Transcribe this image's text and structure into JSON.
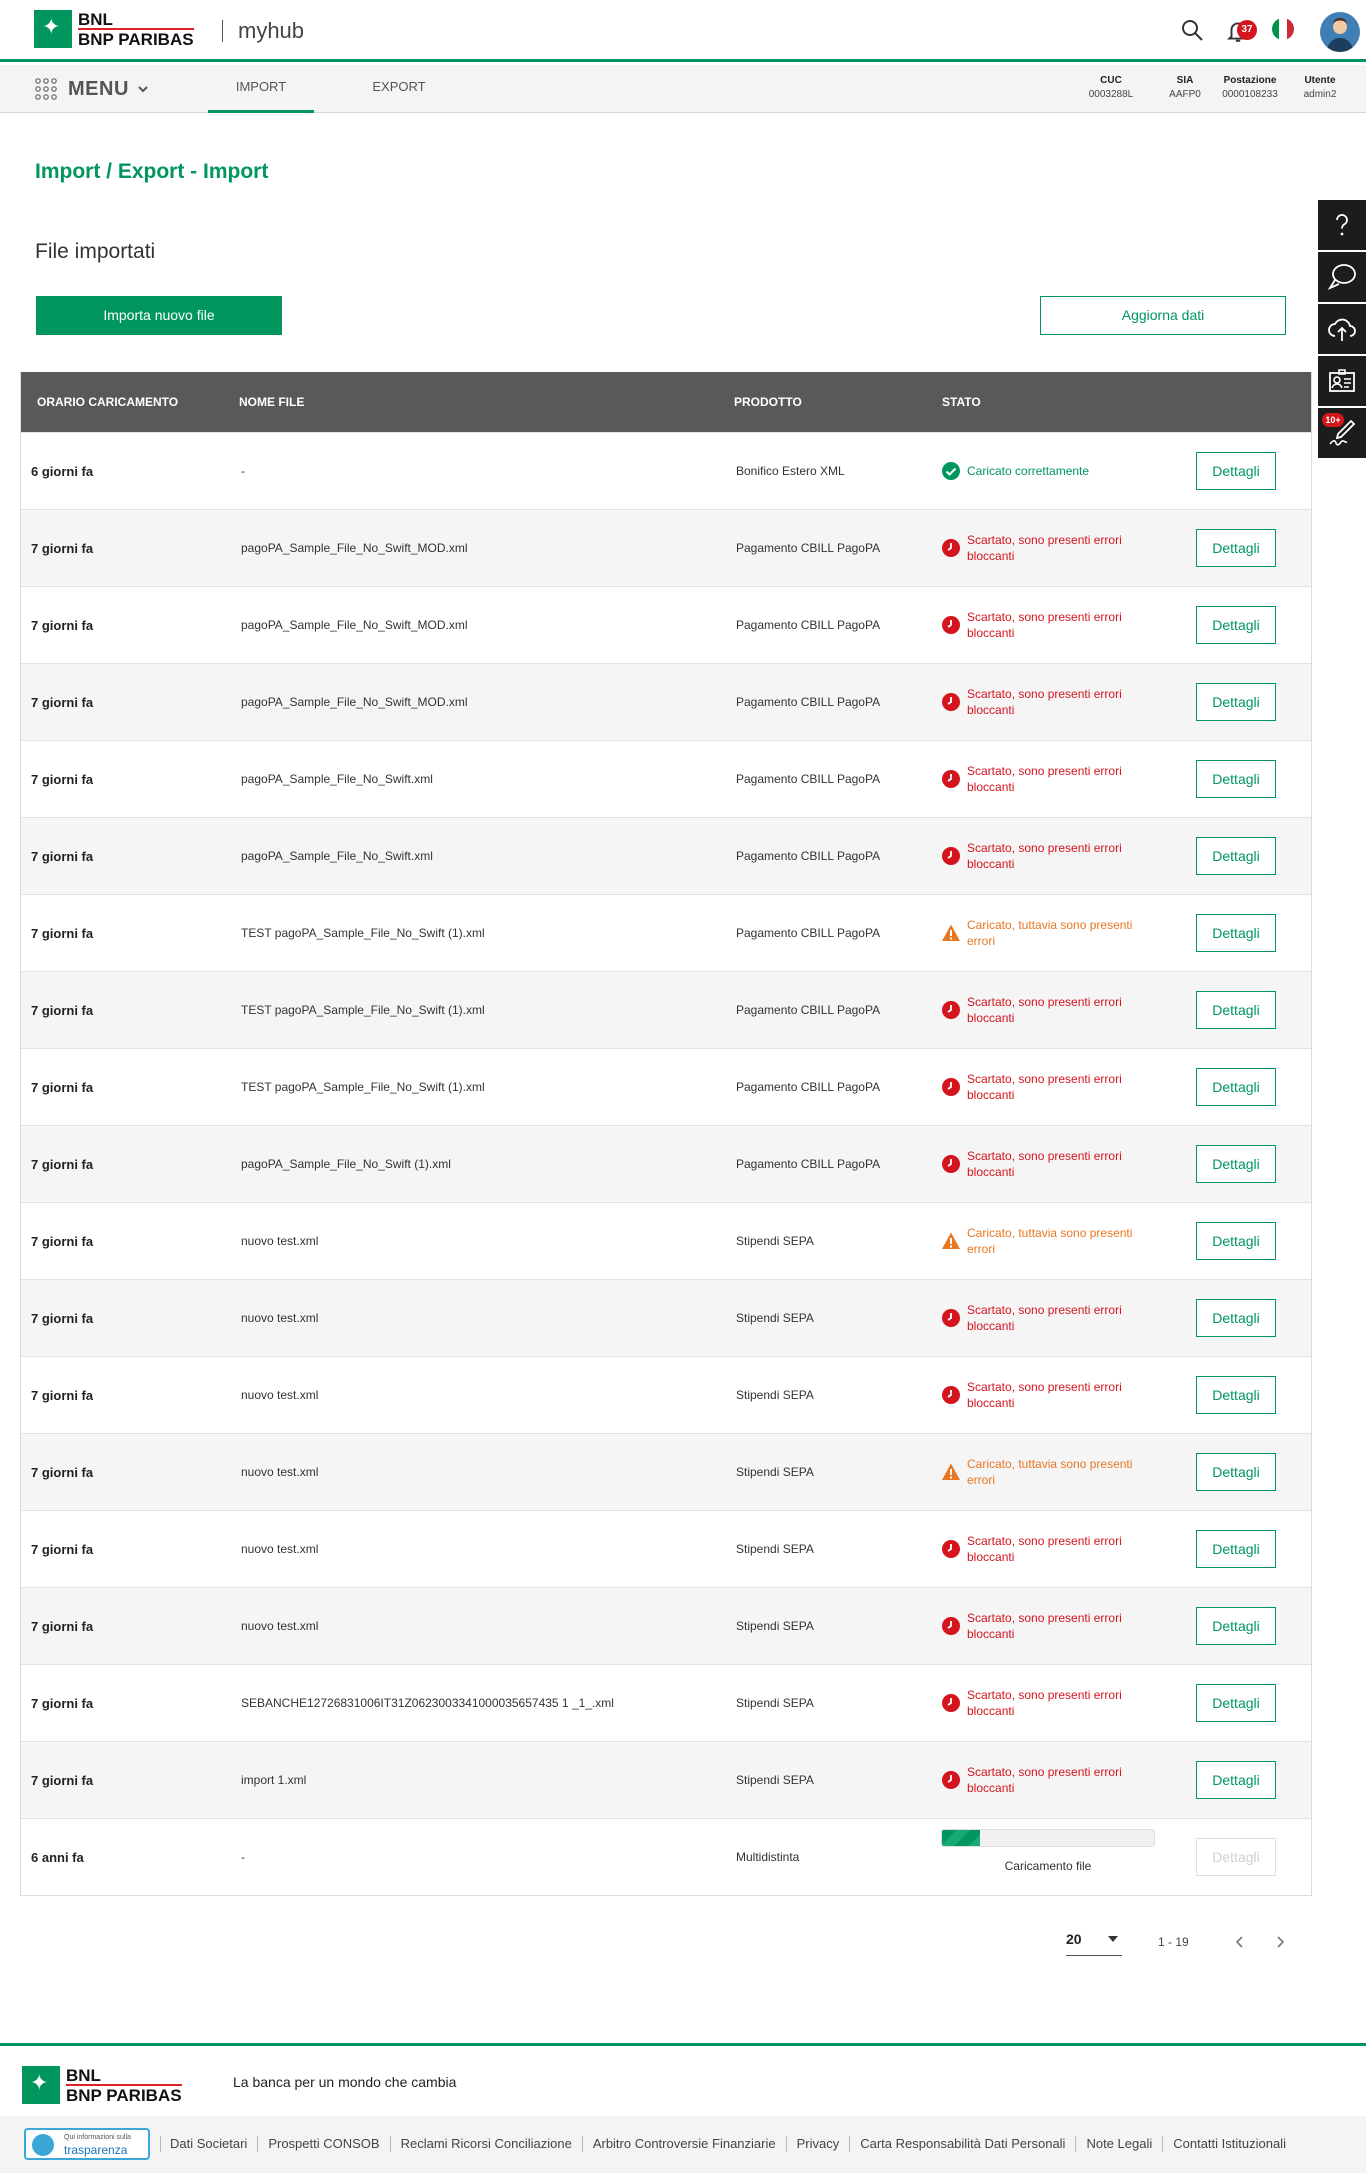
{
  "header": {
    "brand_line1": "BNL",
    "brand_line2": "BNP PARIBAS",
    "app_name": "myhub",
    "notifications_count": "37"
  },
  "nav": {
    "menu_label": "MENU",
    "tabs": [
      {
        "label": "IMPORT"
      },
      {
        "label": "EXPORT"
      }
    ],
    "info": [
      {
        "label": "CUC",
        "value": "0003288L"
      },
      {
        "label": "SIA",
        "value": "AAFP0"
      },
      {
        "label": "Postazione",
        "value": "0000108233"
      },
      {
        "label": "Utente",
        "value": "admin2"
      }
    ]
  },
  "page": {
    "title": "Import / Export - Import",
    "section_title": "File importati",
    "import_button": "Importa nuovo file",
    "refresh_button": "Aggiorna dati"
  },
  "table": {
    "headers": [
      "ORARIO CARICAMENTO",
      "NOME FILE",
      "PRODOTTO",
      "STATO"
    ],
    "details_label": "Dettagli",
    "rows": [
      {
        "time": "6 giorni fa",
        "file": "-",
        "product": "Bonifico Estero XML",
        "status": "Caricato correttamente",
        "kind": "ok"
      },
      {
        "time": "7 giorni fa",
        "file": "pagoPA_Sample_File_No_Swift_MOD.xml",
        "product": "Pagamento CBILL PagoPA",
        "status": "Scartato, sono presenti errori bloccanti",
        "kind": "err"
      },
      {
        "time": "7 giorni fa",
        "file": "pagoPA_Sample_File_No_Swift_MOD.xml",
        "product": "Pagamento CBILL PagoPA",
        "status": "Scartato, sono presenti errori bloccanti",
        "kind": "err"
      },
      {
        "time": "7 giorni fa",
        "file": "pagoPA_Sample_File_No_Swift_MOD.xml",
        "product": "Pagamento CBILL PagoPA",
        "status": "Scartato, sono presenti errori bloccanti",
        "kind": "err"
      },
      {
        "time": "7 giorni fa",
        "file": "pagoPA_Sample_File_No_Swift.xml",
        "product": "Pagamento CBILL PagoPA",
        "status": "Scartato, sono presenti errori bloccanti",
        "kind": "err"
      },
      {
        "time": "7 giorni fa",
        "file": "pagoPA_Sample_File_No_Swift.xml",
        "product": "Pagamento CBILL PagoPA",
        "status": "Scartato, sono presenti errori bloccanti",
        "kind": "err"
      },
      {
        "time": "7 giorni fa",
        "file": "TEST pagoPA_Sample_File_No_Swift (1).xml",
        "product": "Pagamento CBILL PagoPA",
        "status": "Caricato, tuttavia sono presenti errori",
        "kind": "warn"
      },
      {
        "time": "7 giorni fa",
        "file": "TEST pagoPA_Sample_File_No_Swift (1).xml",
        "product": "Pagamento CBILL PagoPA",
        "status": "Scartato, sono presenti errori bloccanti",
        "kind": "err"
      },
      {
        "time": "7 giorni fa",
        "file": "TEST pagoPA_Sample_File_No_Swift (1).xml",
        "product": "Pagamento CBILL PagoPA",
        "status": "Scartato, sono presenti errori bloccanti",
        "kind": "err"
      },
      {
        "time": "7 giorni fa",
        "file": "pagoPA_Sample_File_No_Swift (1).xml",
        "product": "Pagamento CBILL PagoPA",
        "status": "Scartato, sono presenti errori bloccanti",
        "kind": "err"
      },
      {
        "time": "7 giorni fa",
        "file": "nuovo test.xml",
        "product": "Stipendi SEPA",
        "status": "Caricato, tuttavia sono presenti errori",
        "kind": "warn"
      },
      {
        "time": "7 giorni fa",
        "file": "nuovo test.xml",
        "product": "Stipendi SEPA",
        "status": "Scartato, sono presenti errori bloccanti",
        "kind": "err"
      },
      {
        "time": "7 giorni fa",
        "file": "nuovo test.xml",
        "product": "Stipendi SEPA",
        "status": "Scartato, sono presenti errori bloccanti",
        "kind": "err"
      },
      {
        "time": "7 giorni fa",
        "file": "nuovo test.xml",
        "product": "Stipendi SEPA",
        "status": "Caricato, tuttavia sono presenti errori",
        "kind": "warn"
      },
      {
        "time": "7 giorni fa",
        "file": "nuovo test.xml",
        "product": "Stipendi SEPA",
        "status": "Scartato, sono presenti errori bloccanti",
        "kind": "err"
      },
      {
        "time": "7 giorni fa",
        "file": "nuovo test.xml",
        "product": "Stipendi SEPA",
        "status": "Scartato, sono presenti errori bloccanti",
        "kind": "err"
      },
      {
        "time": "7 giorni fa",
        "file": "SEBANCHE12726831006IT31Z0623003341000035657435 1 _1_.xml",
        "product": "Stipendi SEPA",
        "status": "Scartato, sono presenti errori bloccanti",
        "kind": "err"
      },
      {
        "time": "7 giorni fa",
        "file": "import 1.xml",
        "product": "Stipendi SEPA",
        "status": "Scartato, sono presenti errori bloccanti",
        "kind": "err"
      },
      {
        "time": "6 anni fa",
        "file": "-",
        "product": "Multidistinta",
        "status": "Caricamento file",
        "kind": "progress",
        "progress": 0.18
      }
    ]
  },
  "pagination": {
    "page_size": "20",
    "range": "1 - 19"
  },
  "footer": {
    "claim": "La banca per un mondo che cambia",
    "trasparenza_small": "Qui informazioni sulla",
    "trasparenza": "trasparenza",
    "links": [
      "Dati Societari",
      "Prospetti CONSOB",
      "Reclami Ricorsi Conciliazione",
      "Arbitro Controversie Finanziarie",
      "Privacy",
      "Carta Responsabilità Dati Personali",
      "Note Legali",
      "Contatti Istituzionali"
    ]
  },
  "colors": {
    "brand_green": "#00965e",
    "error_red": "#d4151e",
    "warning_orange": "#e87722",
    "table_header": "#595959"
  },
  "icons": [
    "search-icon",
    "bell-icon",
    "italy-flag-icon",
    "avatar",
    "grid-menu-icon",
    "chevron-down-icon",
    "help-icon",
    "chat-icon",
    "upload-icon",
    "contact-card-icon",
    "signature-icon"
  ]
}
